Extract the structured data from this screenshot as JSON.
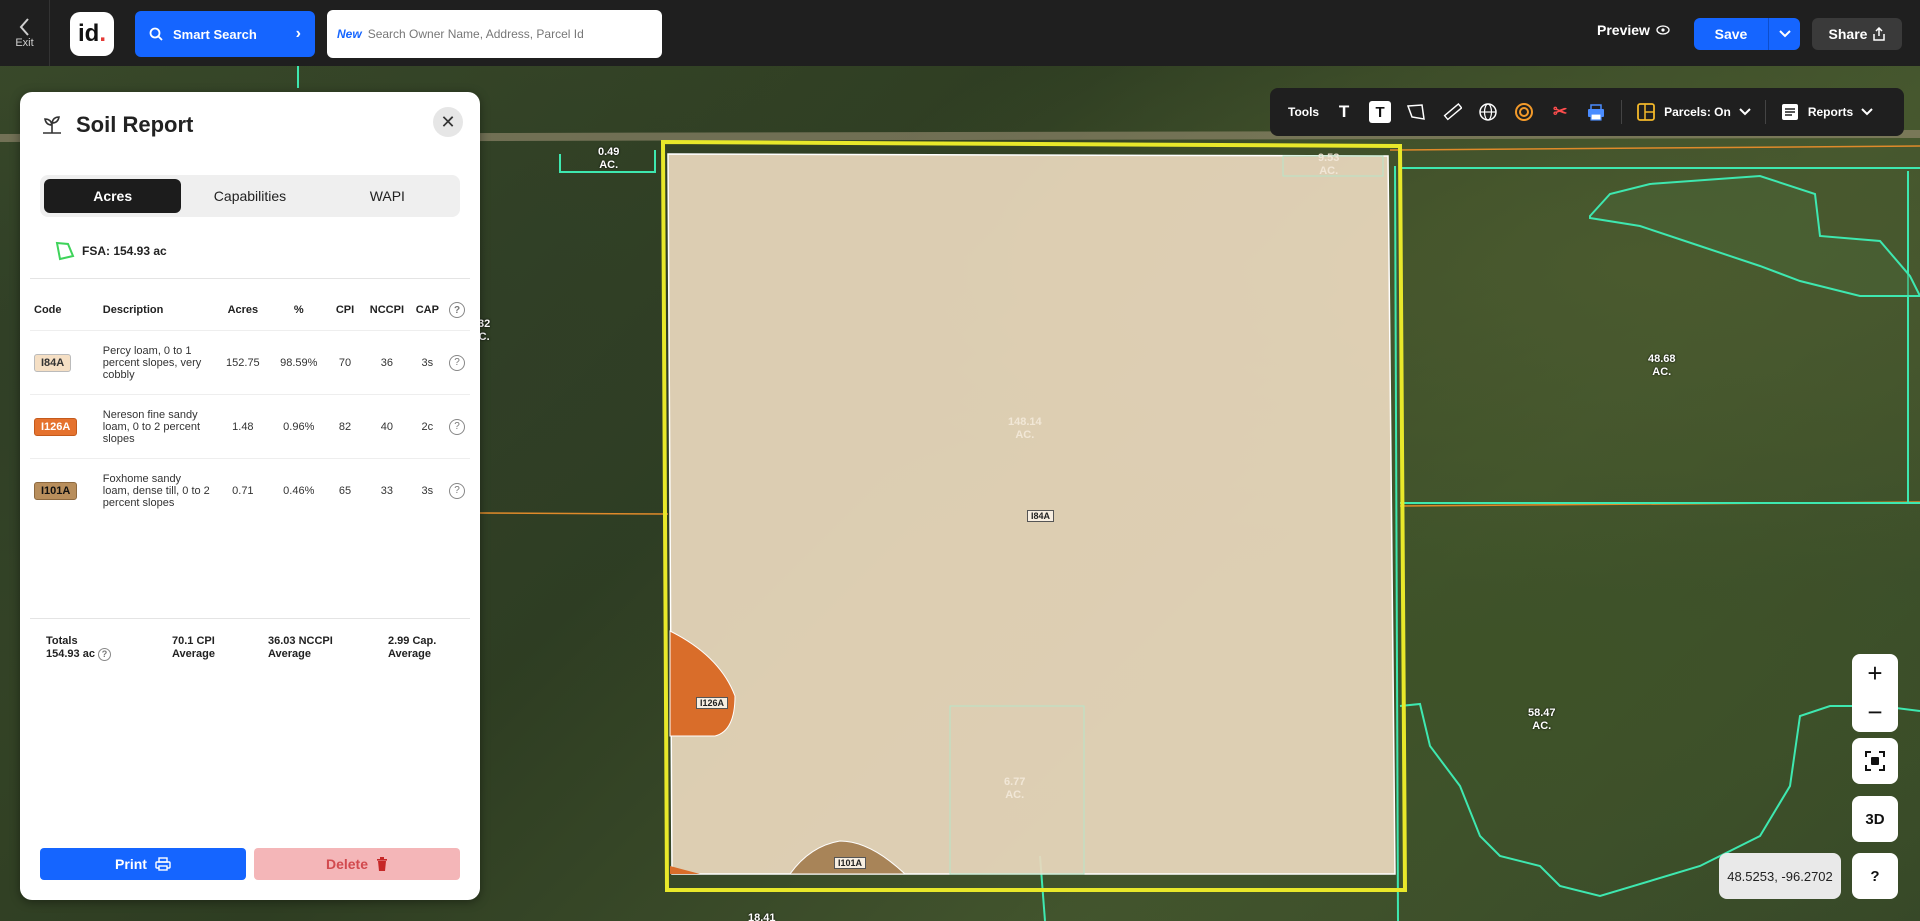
{
  "topbar": {
    "exit_label": "Exit",
    "logo_text": "id",
    "smart_search_label": "Smart Search",
    "search_new_label": "New",
    "search_placeholder": "Search Owner Name, Address, Parcel Id",
    "preview_label": "Preview",
    "save_label": "Save",
    "share_label": "Share"
  },
  "tools": {
    "label": "Tools",
    "icons": [
      "text-icon",
      "text-box-icon",
      "polygon-icon",
      "ruler-icon",
      "globe-icon",
      "buffer-icon",
      "scissors-icon",
      "printer-icon"
    ],
    "parcels_label": "Parcels: On",
    "reports_label": "Reports"
  },
  "map": {
    "acre_labels": [
      {
        "value": "0.49",
        "unit": "AC."
      },
      {
        "value": "9.53",
        "unit": "AC."
      },
      {
        "value": "32",
        "unit": "C."
      },
      {
        "value": "148.14",
        "unit": "AC."
      },
      {
        "value": "48.68",
        "unit": "AC."
      },
      {
        "value": "58.47",
        "unit": "AC."
      },
      {
        "value": "6.77",
        "unit": "AC."
      },
      {
        "value": "18.41",
        "unit": ""
      }
    ],
    "soil_tags": [
      "I84A",
      "I126A",
      "I101A"
    ],
    "coordinates": "48.5253, -96.2702",
    "zoom_in": "+",
    "zoom_out": "−",
    "btn_3d": "3D",
    "btn_help": "?",
    "attribution": "box"
  },
  "soil_report": {
    "title": "Soil Report",
    "tabs": [
      "Acres",
      "Capabilities",
      "WAPI"
    ],
    "active_tab": "Acres",
    "fsa_label": "FSA: 154.93 ac",
    "columns": [
      "Code",
      "Description",
      "Acres",
      "%",
      "CPI",
      "NCCPI",
      "CAP"
    ],
    "rows": [
      {
        "code": "I84A",
        "color": "#f5dfc4",
        "description": "Percy loam, 0 to 1 percent slopes, very cobbly",
        "acres": "152.75",
        "percent": "98.59%",
        "cpi": "70",
        "nccpi": "36",
        "cap": "3s"
      },
      {
        "code": "I126A",
        "color": "#e5722e",
        "description": "Nereson fine sandy loam, 0 to 2 percent slopes",
        "acres": "1.48",
        "percent": "0.96%",
        "cpi": "82",
        "nccpi": "40",
        "cap": "2c"
      },
      {
        "code": "I101A",
        "color": "#b88e5c",
        "description": "Foxhome sandy loam, dense till, 0 to 2 percent slopes",
        "acres": "0.71",
        "percent": "0.46%",
        "cpi": "65",
        "nccpi": "33",
        "cap": "3s"
      }
    ],
    "totals": {
      "label": "Totals",
      "acres": "154.93 ac",
      "cpi_value": "70.1 CPI",
      "cpi_sub": "Average",
      "nccpi_value": "36.03 NCCPI",
      "nccpi_sub": "Average",
      "cap_value": "2.99 Cap.",
      "cap_sub": "Average"
    },
    "print_label": "Print",
    "delete_label": "Delete"
  },
  "colors": {
    "accent": "#1565ff",
    "parcel_outline": "#3ee8b0",
    "selected_outline": "#e8e82a",
    "soil_fill": "#e9d8bd"
  }
}
